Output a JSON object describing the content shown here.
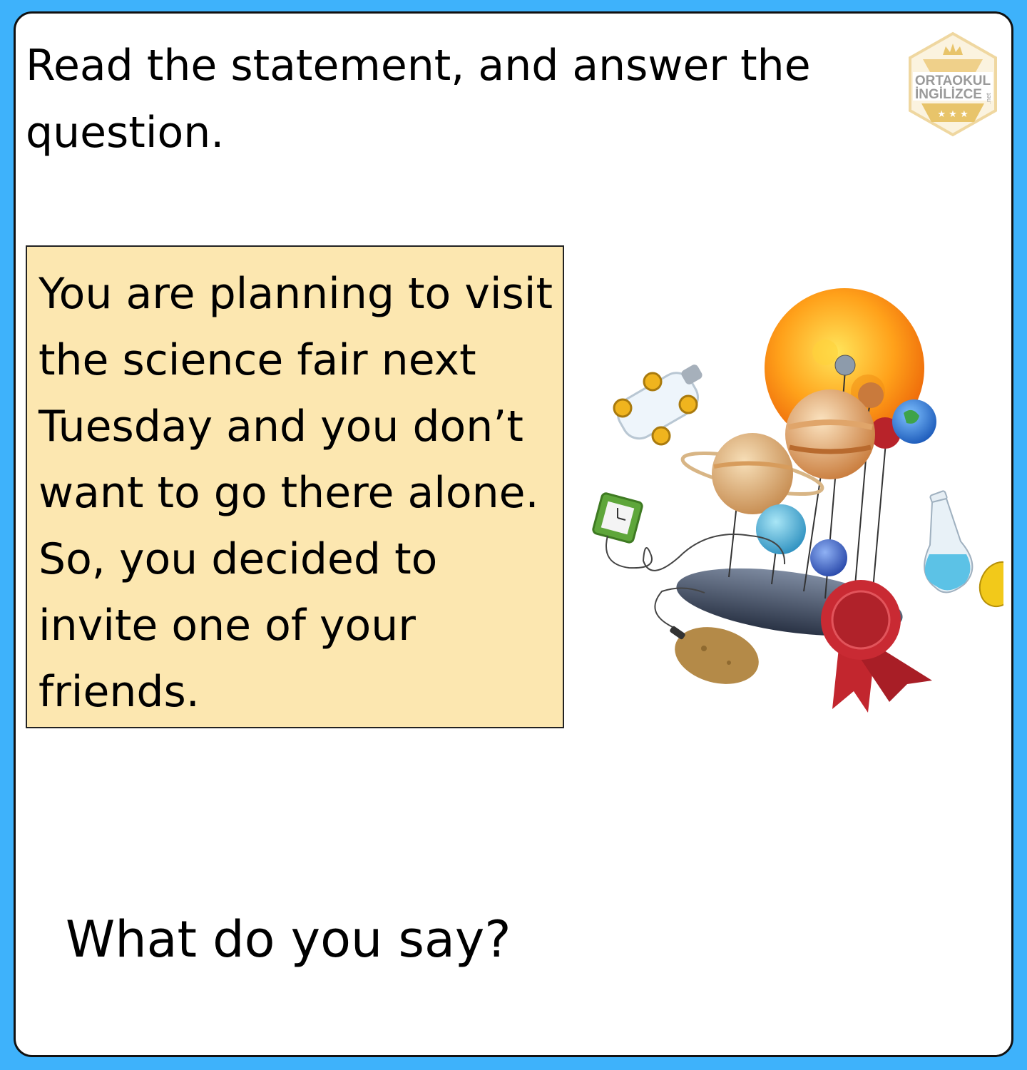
{
  "instruction": "Read the statement, and answer the question.",
  "logo": {
    "line1": "ORTAOKUL",
    "line2": "İNGİLİZCE",
    "suffix": ".net",
    "colors": {
      "gold": "#e8c46a",
      "gray": "#9a9a9a"
    }
  },
  "statement": "You are planning to visit the science fair next Tuesday and you don’t want to go there alone. So, you decided to invite one of your friends.",
  "question": "What do you say?",
  "illustration": {
    "subject": "science fair items: sun and planet model, bottle car, clock, potato battery, flask, lemon, award ribbon",
    "icons": [
      "sun-icon",
      "planets-model-icon",
      "bottle-car-icon",
      "clock-icon",
      "potato-icon",
      "flask-icon",
      "lemon-icon",
      "award-ribbon-icon"
    ]
  },
  "colors": {
    "background": "#3eb2fb",
    "card": "#ffffff",
    "statement_box": "#fce7b0",
    "text": "#000000"
  }
}
